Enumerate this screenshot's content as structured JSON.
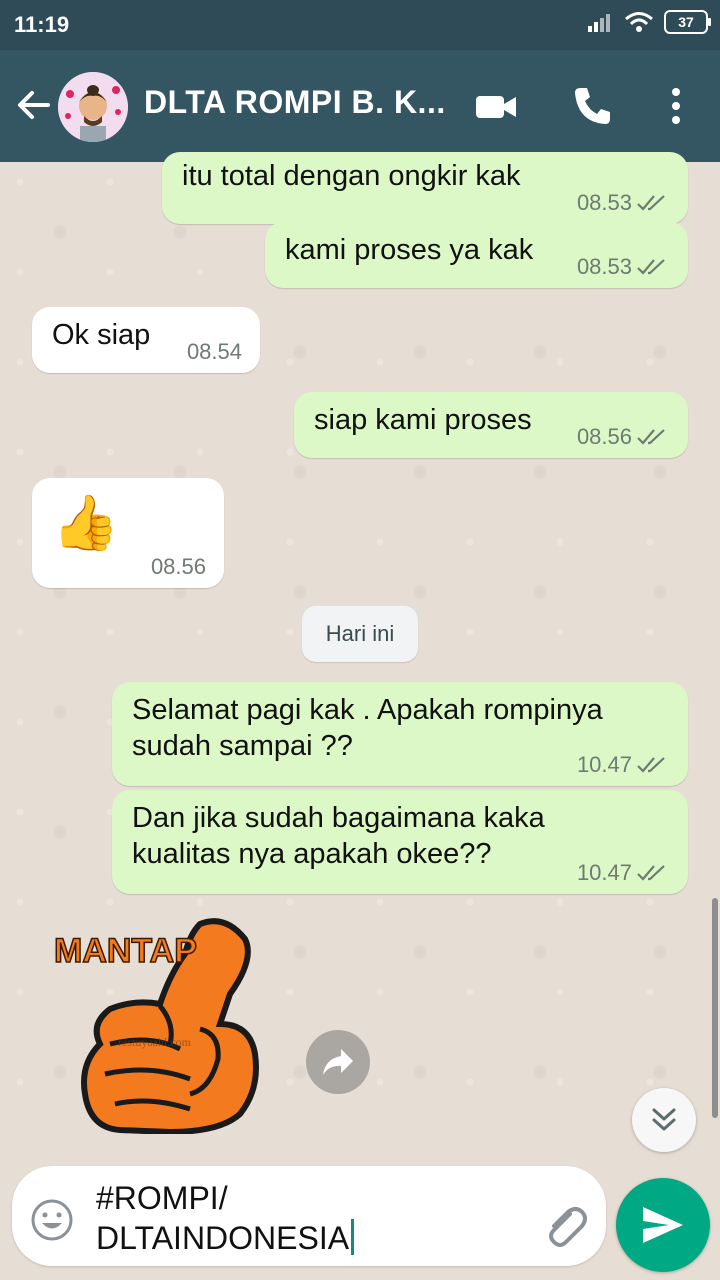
{
  "status_bar": {
    "time": "11:19",
    "battery": "37"
  },
  "header": {
    "title": "DLTA ROMPI B. K...",
    "icons": [
      "back-arrow-icon",
      "video-call-icon",
      "phone-icon",
      "more-vert-icon"
    ]
  },
  "messages": [
    {
      "direction": "out",
      "text": "itu total dengan ongkir kak",
      "time": "08.53",
      "status": "read"
    },
    {
      "direction": "out",
      "text": "kami proses ya kak",
      "time": "08.53",
      "status": "read"
    },
    {
      "direction": "in",
      "text": "Ok siap",
      "time": "08.54"
    },
    {
      "direction": "out",
      "text": "siap kami proses",
      "time": "08.56",
      "status": "read"
    },
    {
      "direction": "in",
      "text": "👍",
      "time": "08.56"
    },
    {
      "direction": "out",
      "text": "Selamat pagi kak . Apakah rompinya sudah sampai ??",
      "time": "10.47",
      "status": "read"
    },
    {
      "direction": "out",
      "text": "Dan jika sudah bagaimana kaka kualitas nya apakah okee??",
      "time": "10.47",
      "status": "read"
    }
  ],
  "date_divider": "Hari ini",
  "sticker": {
    "text": "MANTAP",
    "watermark": "restuyaahl.com"
  },
  "composer": {
    "value": "#ROMPI/\nDLTAINDONESIA",
    "icons": [
      "emoji-icon",
      "attach-icon",
      "send-icon"
    ]
  },
  "colors": {
    "header": "#345663",
    "statusbar": "#2f4b57",
    "outgoing_bubble": "#dcf8c6",
    "incoming_bubble": "#ffffff",
    "chat_bg": "#e6ddd4",
    "send_button": "#00a884",
    "read_ticks": "#6f7a73"
  }
}
